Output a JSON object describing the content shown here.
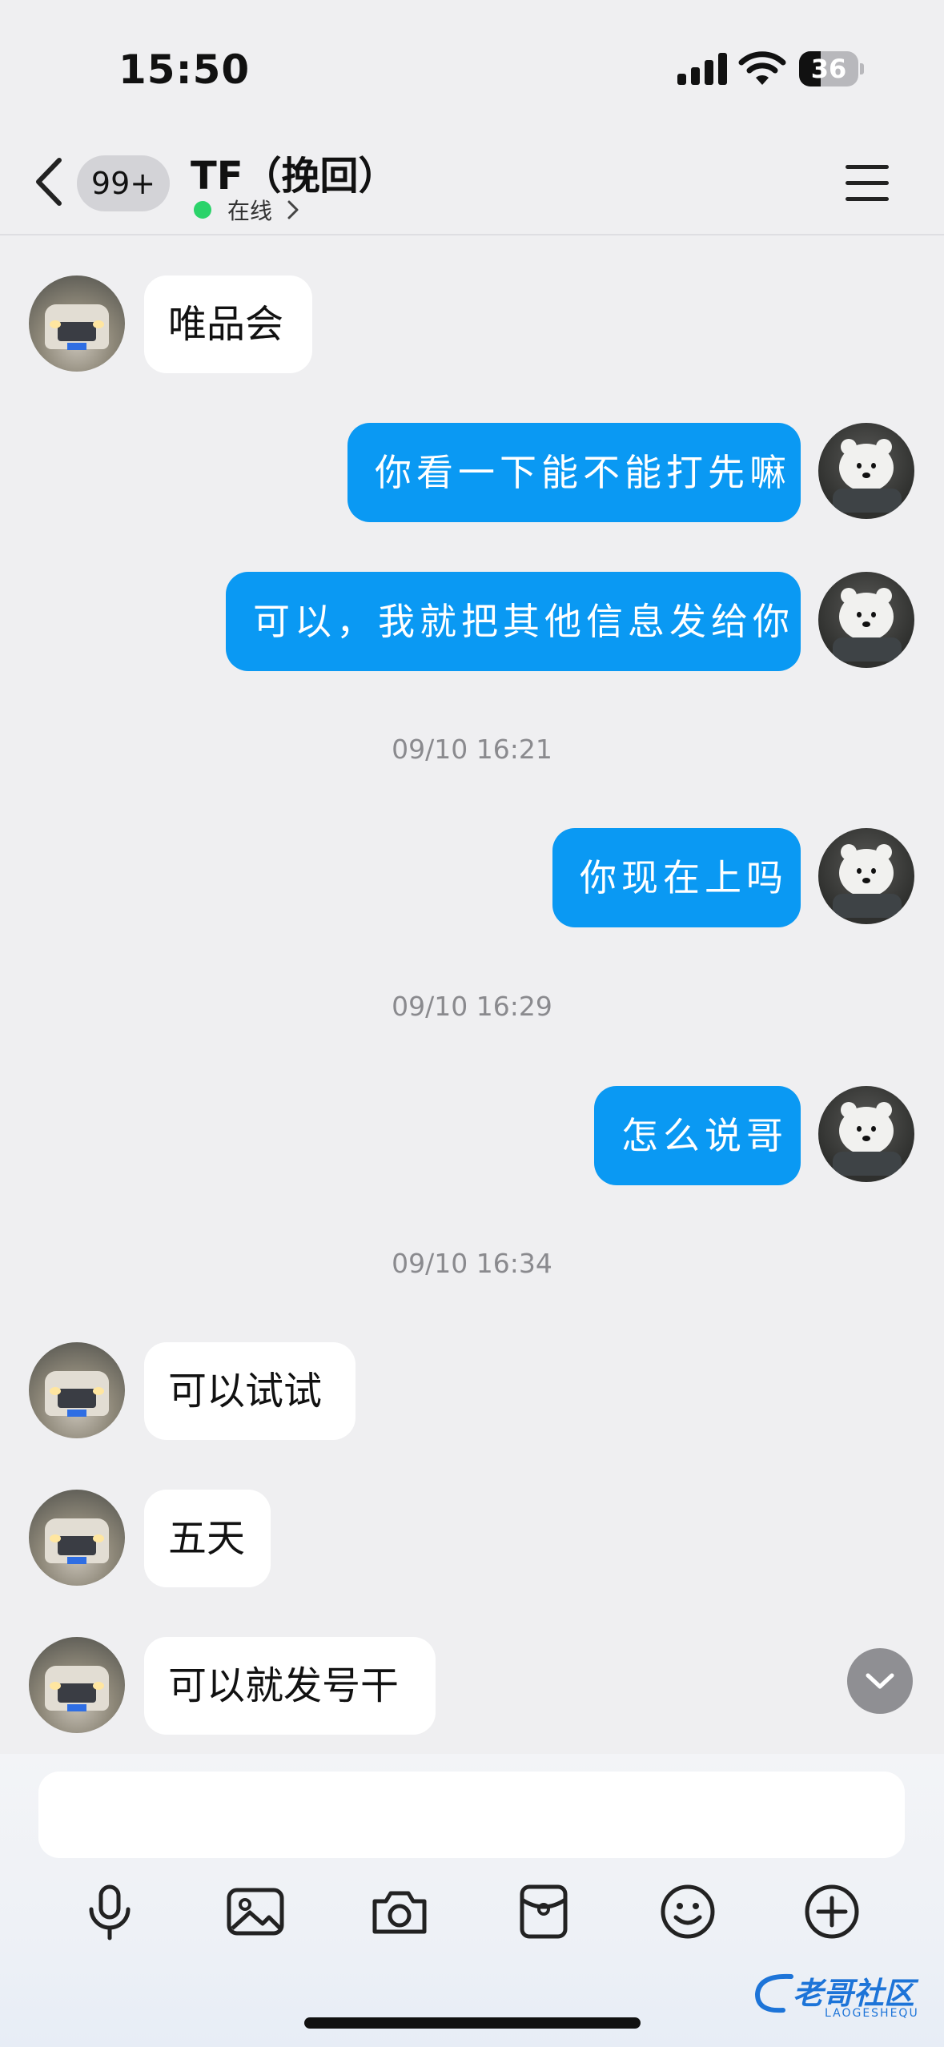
{
  "status_bar": {
    "time": "15:50",
    "battery": "36",
    "battery_fraction": 0.36
  },
  "nav": {
    "unread_badge": "99+",
    "title": "TF（挽回）",
    "status": "在线"
  },
  "messages": [
    {
      "side": "in",
      "text": "唯品会"
    },
    {
      "side": "out",
      "text": "你看一下能不能打先嘛"
    },
    {
      "side": "out",
      "text": "可以，我就把其他信息发给你"
    },
    {
      "type": "timestamp",
      "text": "09/10 16:21"
    },
    {
      "side": "out",
      "text": "你现在上吗"
    },
    {
      "type": "timestamp",
      "text": "09/10 16:29"
    },
    {
      "side": "out",
      "text": "怎么说哥"
    },
    {
      "type": "timestamp",
      "text": "09/10 16:34"
    },
    {
      "side": "in",
      "text": "可以试试"
    },
    {
      "side": "in",
      "text": "五天"
    },
    {
      "side": "in",
      "text": "可以就发号干"
    }
  ],
  "input": {
    "value": "",
    "placeholder": ""
  },
  "toolbar": [
    "microphone-icon",
    "image-icon",
    "camera-icon",
    "red-packet-icon",
    "emoji-icon",
    "plus-icon"
  ],
  "watermark": {
    "text": "老哥社区",
    "sub": "LAOGESHEQU"
  },
  "colors": {
    "outgoing_bubble": "#0a99f3",
    "incoming_bubble": "#ffffff",
    "online_dot": "#2bd36a",
    "background": "#efeff1"
  }
}
